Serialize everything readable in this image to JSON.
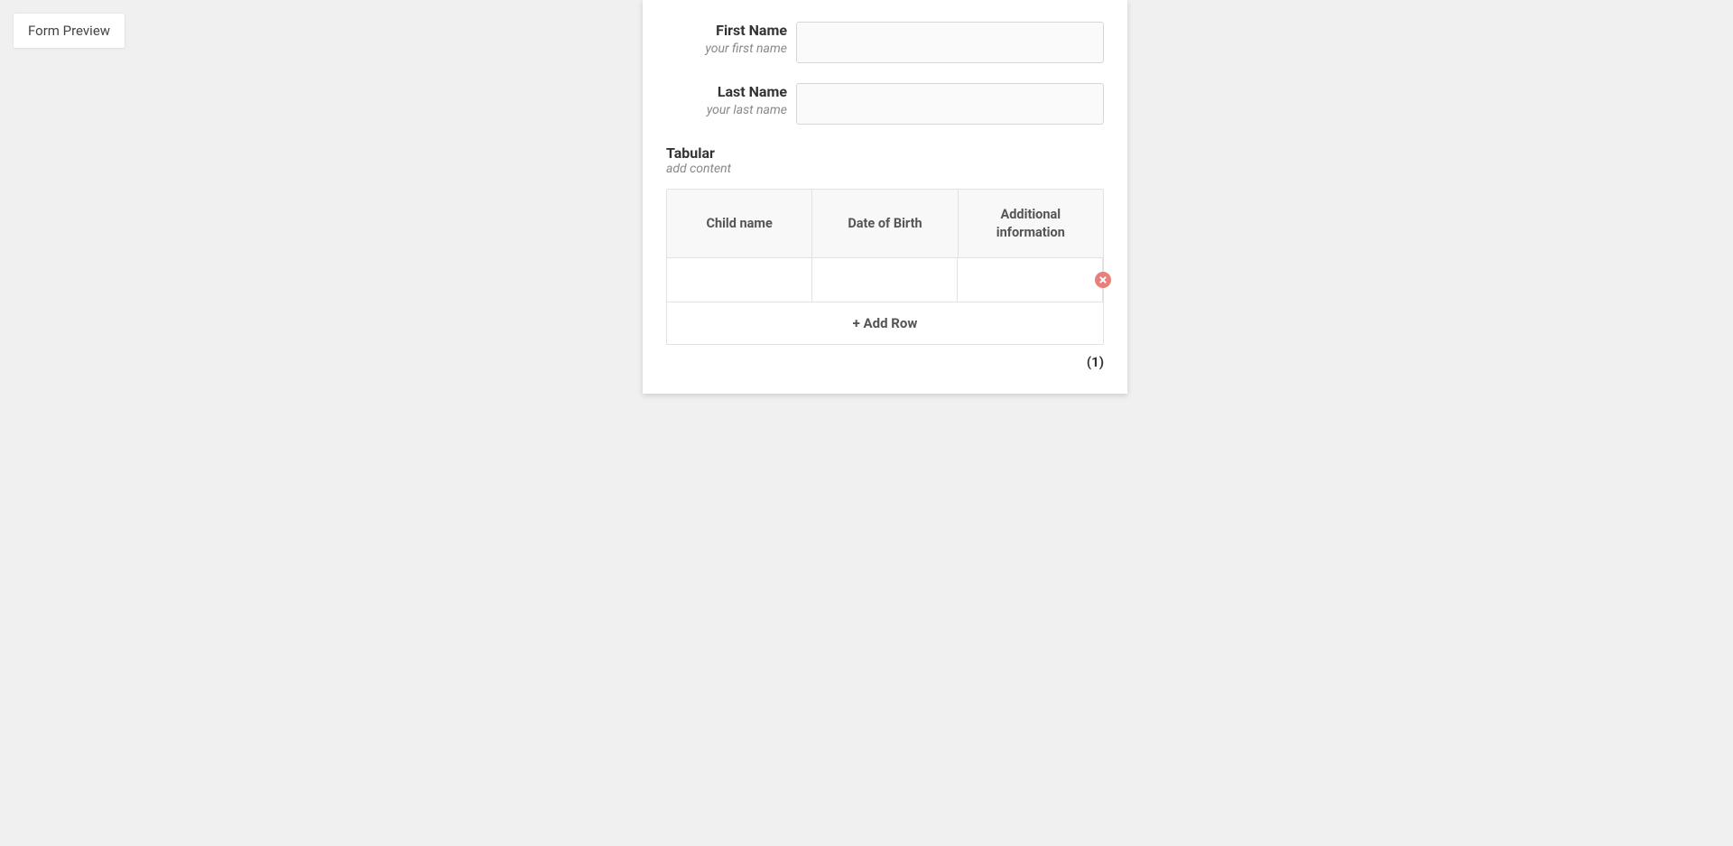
{
  "tag": {
    "label": "Form Preview"
  },
  "form": {
    "firstName": {
      "label": "First Name",
      "hint": "your first name",
      "value": ""
    },
    "lastName": {
      "label": "Last Name",
      "hint": "your last name",
      "value": ""
    },
    "tabular": {
      "title": "Tabular",
      "hint": "add content",
      "columns": [
        "Child name",
        "Date of Birth",
        "Additional information"
      ],
      "addRowLabel": "+ Add Row",
      "rowCount": "(1)"
    }
  }
}
